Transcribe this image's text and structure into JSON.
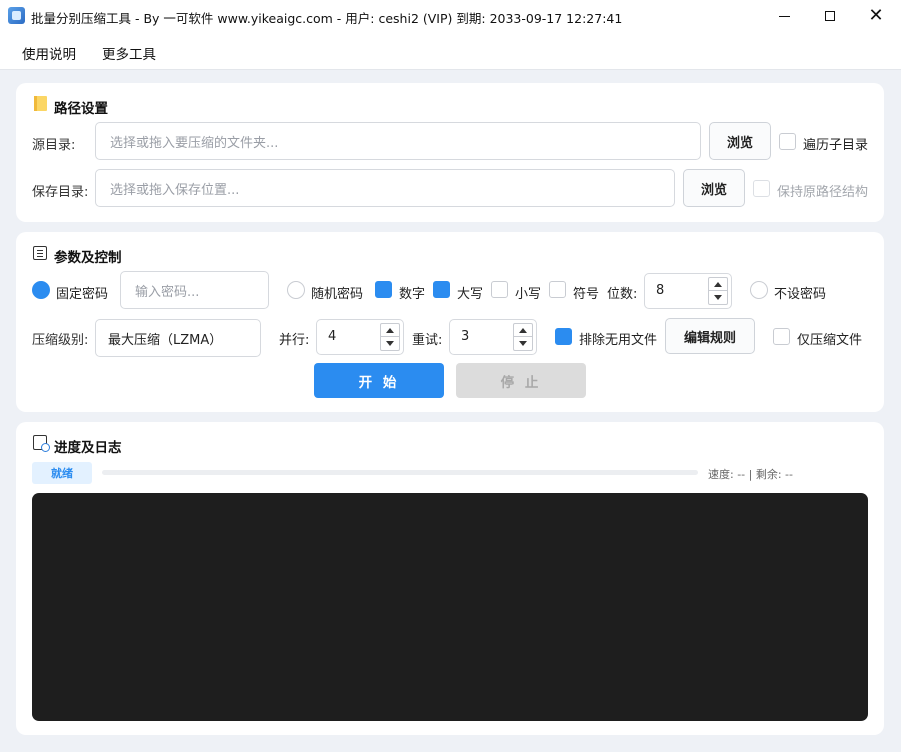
{
  "window": {
    "title": "批量分别压缩工具 - By 一可软件 www.yikeaigc.com - 用户: ceshi2 (VIP) 到期: 2033-09-17 12:27:41"
  },
  "menu": {
    "items": [
      "使用说明",
      "更多工具"
    ]
  },
  "path_section": {
    "title": "路径设置",
    "source_label": "源目录:",
    "source_placeholder": "选择或拖入要压缩的文件夹...",
    "source_browse": "浏览",
    "recursive_label": "遍历子目录",
    "recursive_checked": false,
    "save_label": "保存目录:",
    "save_placeholder": "选择或拖入保存位置...",
    "save_browse": "浏览",
    "keep_structure_label": "保持原路径结构",
    "keep_structure_checked": false,
    "keep_structure_enabled": false
  },
  "params_section": {
    "title": "参数及控制",
    "fixed_password_label": "固定密码",
    "fixed_password_selected": true,
    "password_placeholder": "输入密码...",
    "random_password_label": "随机密码",
    "random_password_selected": false,
    "digits_label": "数字",
    "digits_checked": true,
    "upper_label": "大写",
    "upper_checked": true,
    "lower_label": "小写",
    "lower_checked": false,
    "symbol_label": "符号",
    "symbol_checked": false,
    "length_label": "位数:",
    "length_value": "8",
    "no_password_label": "不设密码",
    "no_password_selected": false,
    "level_label": "压缩级别:",
    "level_value": "最大压缩（LZMA）",
    "parallel_label": "并行:",
    "parallel_value": "4",
    "retry_label": "重试:",
    "retry_value": "3",
    "exclude_label": "排除无用文件",
    "exclude_checked": true,
    "edit_rules_button": "编辑规则",
    "compress_only_label": "仅压缩文件",
    "compress_only_checked": false,
    "start_button": "开 始",
    "stop_button": "停 止"
  },
  "progress_section": {
    "title": "进度及日志",
    "status": "就绪",
    "progress": 0,
    "speed_text": "速度: -- | 剩余: --"
  },
  "colors": {
    "accent": "#2b8cf0",
    "log_background": "#1e1e1e",
    "page_background": "#eef1f6"
  },
  "icons": [
    "app-icon",
    "minimize-icon",
    "maximize-icon",
    "close-icon",
    "folder-icon",
    "list-icon",
    "log-icon",
    "arrow-up-icon",
    "arrow-down-icon"
  ]
}
